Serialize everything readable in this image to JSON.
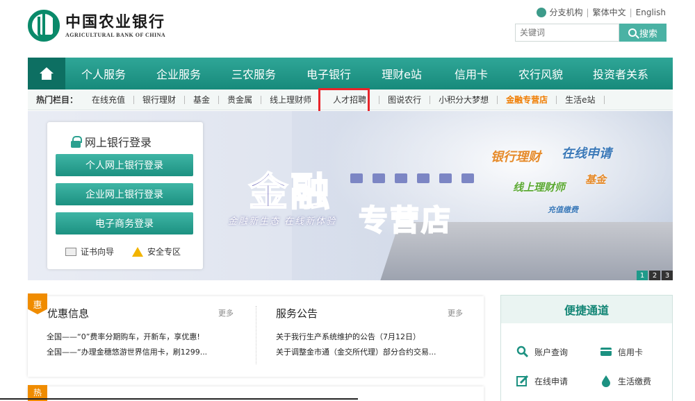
{
  "header": {
    "logo_cn": "中国农业银行",
    "logo_en": "AGRICULTURAL BANK OF CHINA",
    "toplinks": [
      "分支机构",
      "繁体中文",
      "English"
    ],
    "search_placeholder": "关键词",
    "search_button": "搜索"
  },
  "nav": {
    "items": [
      "个人服务",
      "企业服务",
      "三农服务",
      "电子银行",
      "理财e站",
      "信用卡",
      "农行风貌",
      "投资者关系"
    ]
  },
  "hotbar": {
    "label": "热门栏目：",
    "items": [
      "在线充值",
      "银行理财",
      "基金",
      "贵金属",
      "线上理财师",
      "人才招聘",
      "图说农行",
      "小积分大梦想",
      "金融专营店",
      "生活e站"
    ]
  },
  "banner": {
    "title1": "金融",
    "title2": "专营店",
    "slogan": "金融新生态  在线新体验",
    "tags": [
      "银行理财",
      "在线申请",
      "基金",
      "线上理财师",
      "充值缴费"
    ],
    "pager": [
      "1",
      "2",
      "3"
    ]
  },
  "login": {
    "title": "网上银行登录",
    "buttons": [
      "个人网上银行登录",
      "企业网上银行登录",
      "电子商务登录"
    ],
    "links": [
      "证书向导",
      "安全专区"
    ]
  },
  "info": {
    "badge": "惠",
    "promo_title": "优惠信息",
    "promo_more": "更多",
    "promo_items": [
      "全国——“0”费率分期购车，开新车，享优惠!",
      "全国——“办理金穗悠游世界信用卡，刷1299..."
    ],
    "notice_title": "服务公告",
    "notice_more": "更多",
    "notice_items": [
      "关于我行生产系统维护的公告（7月12日）",
      "关于调整金市通（金交所代理）部分合约交易..."
    ]
  },
  "quick": {
    "title": "便捷通道",
    "items": [
      "账户查询",
      "信用卡",
      "在线申请",
      "生活缴费"
    ]
  },
  "bottom": {
    "badge": "热"
  },
  "colors": {
    "brand": "#178a7b",
    "highlight": "#e8242a",
    "accent_orange": "#f07c00"
  }
}
